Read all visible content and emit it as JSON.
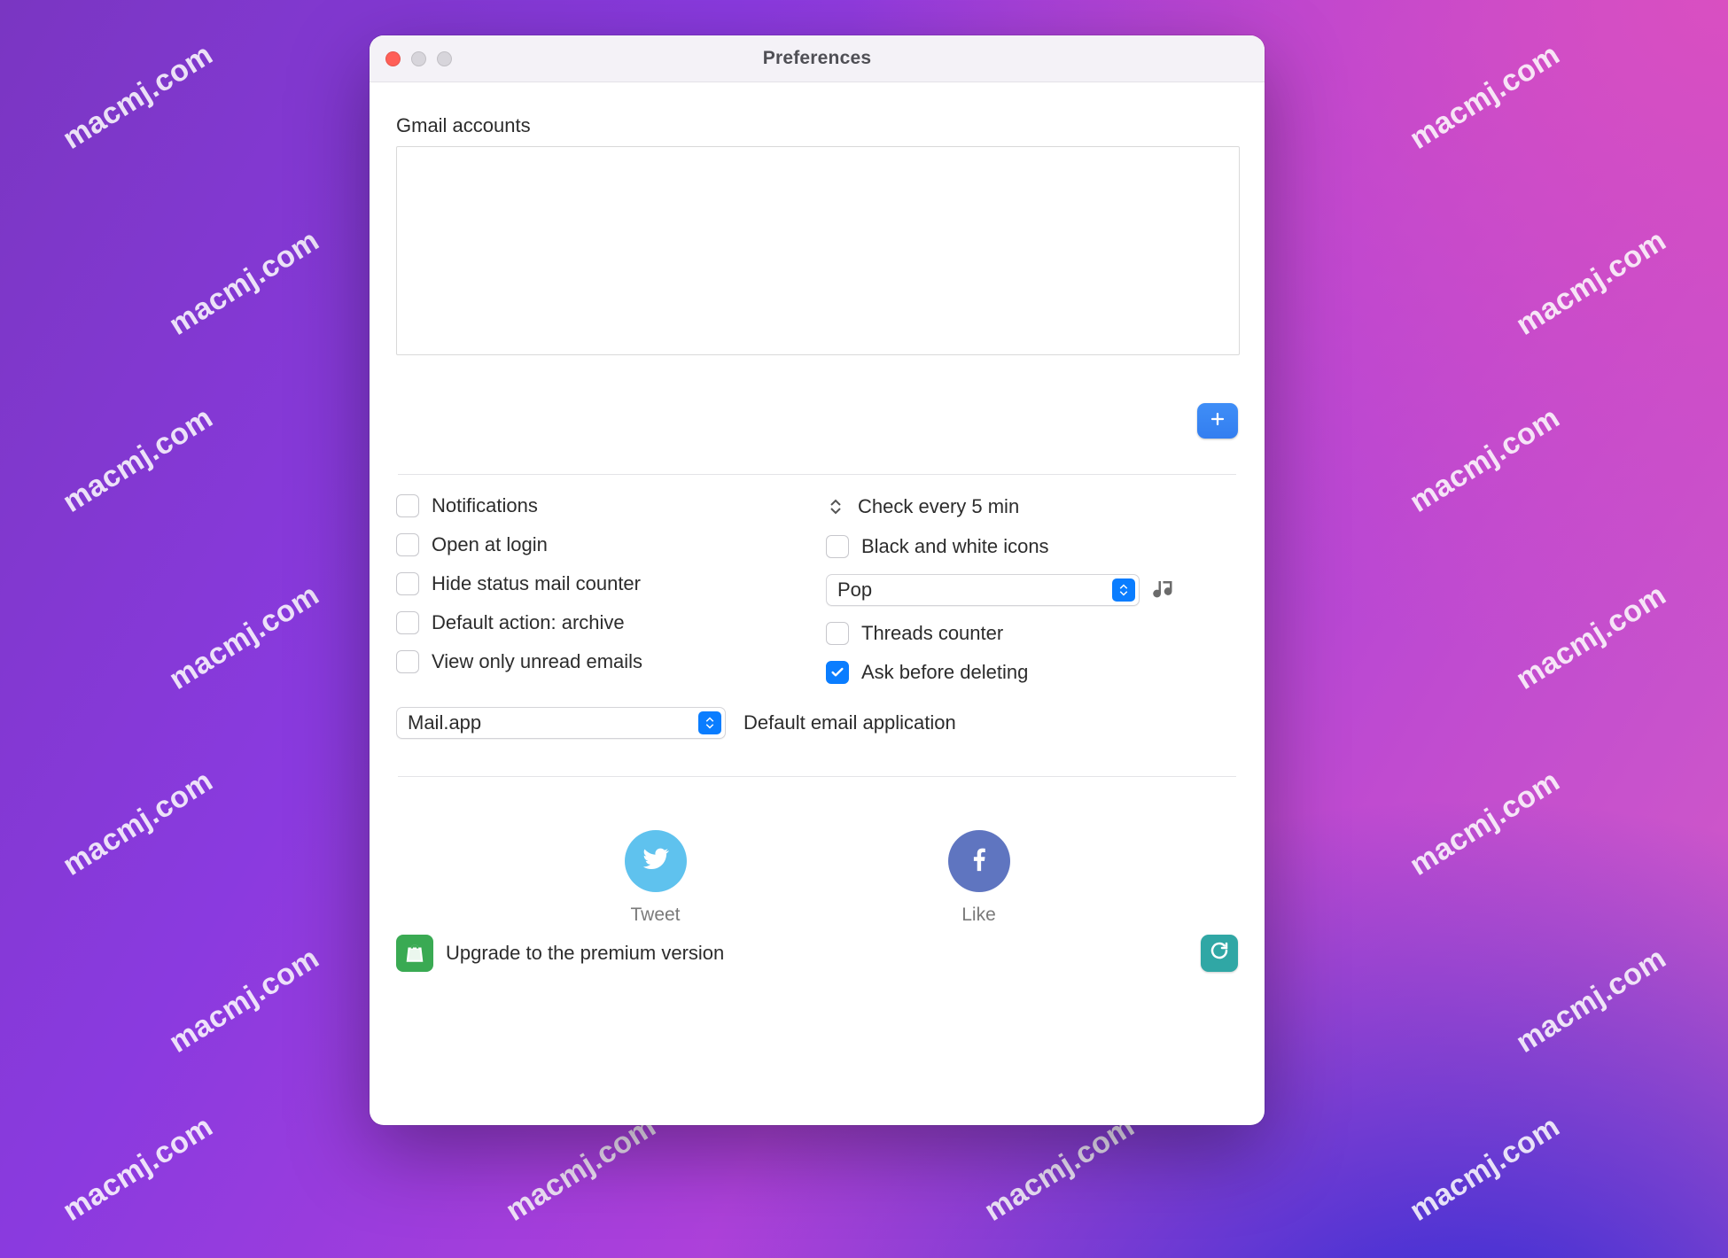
{
  "window": {
    "title": "Preferences"
  },
  "watermark": "macmj.com",
  "accounts": {
    "label": "Gmail accounts"
  },
  "options": {
    "notifications_label": "Notifications",
    "open_at_login_label": "Open at login",
    "hide_status_counter_label": "Hide status mail counter",
    "default_action_archive_label": "Default action: archive",
    "view_only_unread_label": "View only unread emails",
    "check_every_label": "Check every 5 min",
    "bw_icons_label": "Black and white icons",
    "sound_select_value": "Pop",
    "threads_counter_label": "Threads counter",
    "ask_before_deleting_label": "Ask before deleting",
    "checked": {
      "notifications": false,
      "open_at_login": false,
      "hide_status_counter": false,
      "default_action_archive": false,
      "view_only_unread": false,
      "bw_icons": false,
      "threads_counter": false,
      "ask_before_deleting": true
    }
  },
  "default_app": {
    "select_value": "Mail.app",
    "label": "Default email application"
  },
  "social": {
    "tweet_label": "Tweet",
    "like_label": "Like"
  },
  "footer": {
    "upgrade_label": "Upgrade to the premium version"
  }
}
